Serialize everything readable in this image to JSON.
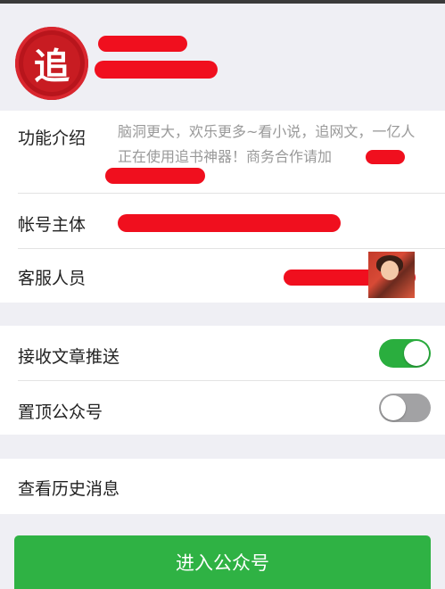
{
  "profile": {
    "logo_glyph": "追",
    "logo_color": "#c81c22"
  },
  "info": {
    "intro_label": "功能介绍",
    "intro_text": "脑洞更大，欢乐更多~看小说，追网文，一亿人正在使用追书神器！商务合作请加",
    "account_label": "帐号主体",
    "service_label": "客服人员"
  },
  "settings": {
    "push_label": "接收文章推送",
    "push_enabled": true,
    "pin_label": "置顶公众号",
    "pin_enabled": false
  },
  "history": {
    "label": "查看历史消息"
  },
  "action": {
    "enter_label": "进入公众号",
    "color": "#2fb244"
  },
  "colors": {
    "toggle_on": "#2aae3e",
    "toggle_off": "#a2a2a4",
    "redaction": "#f00f1e"
  }
}
